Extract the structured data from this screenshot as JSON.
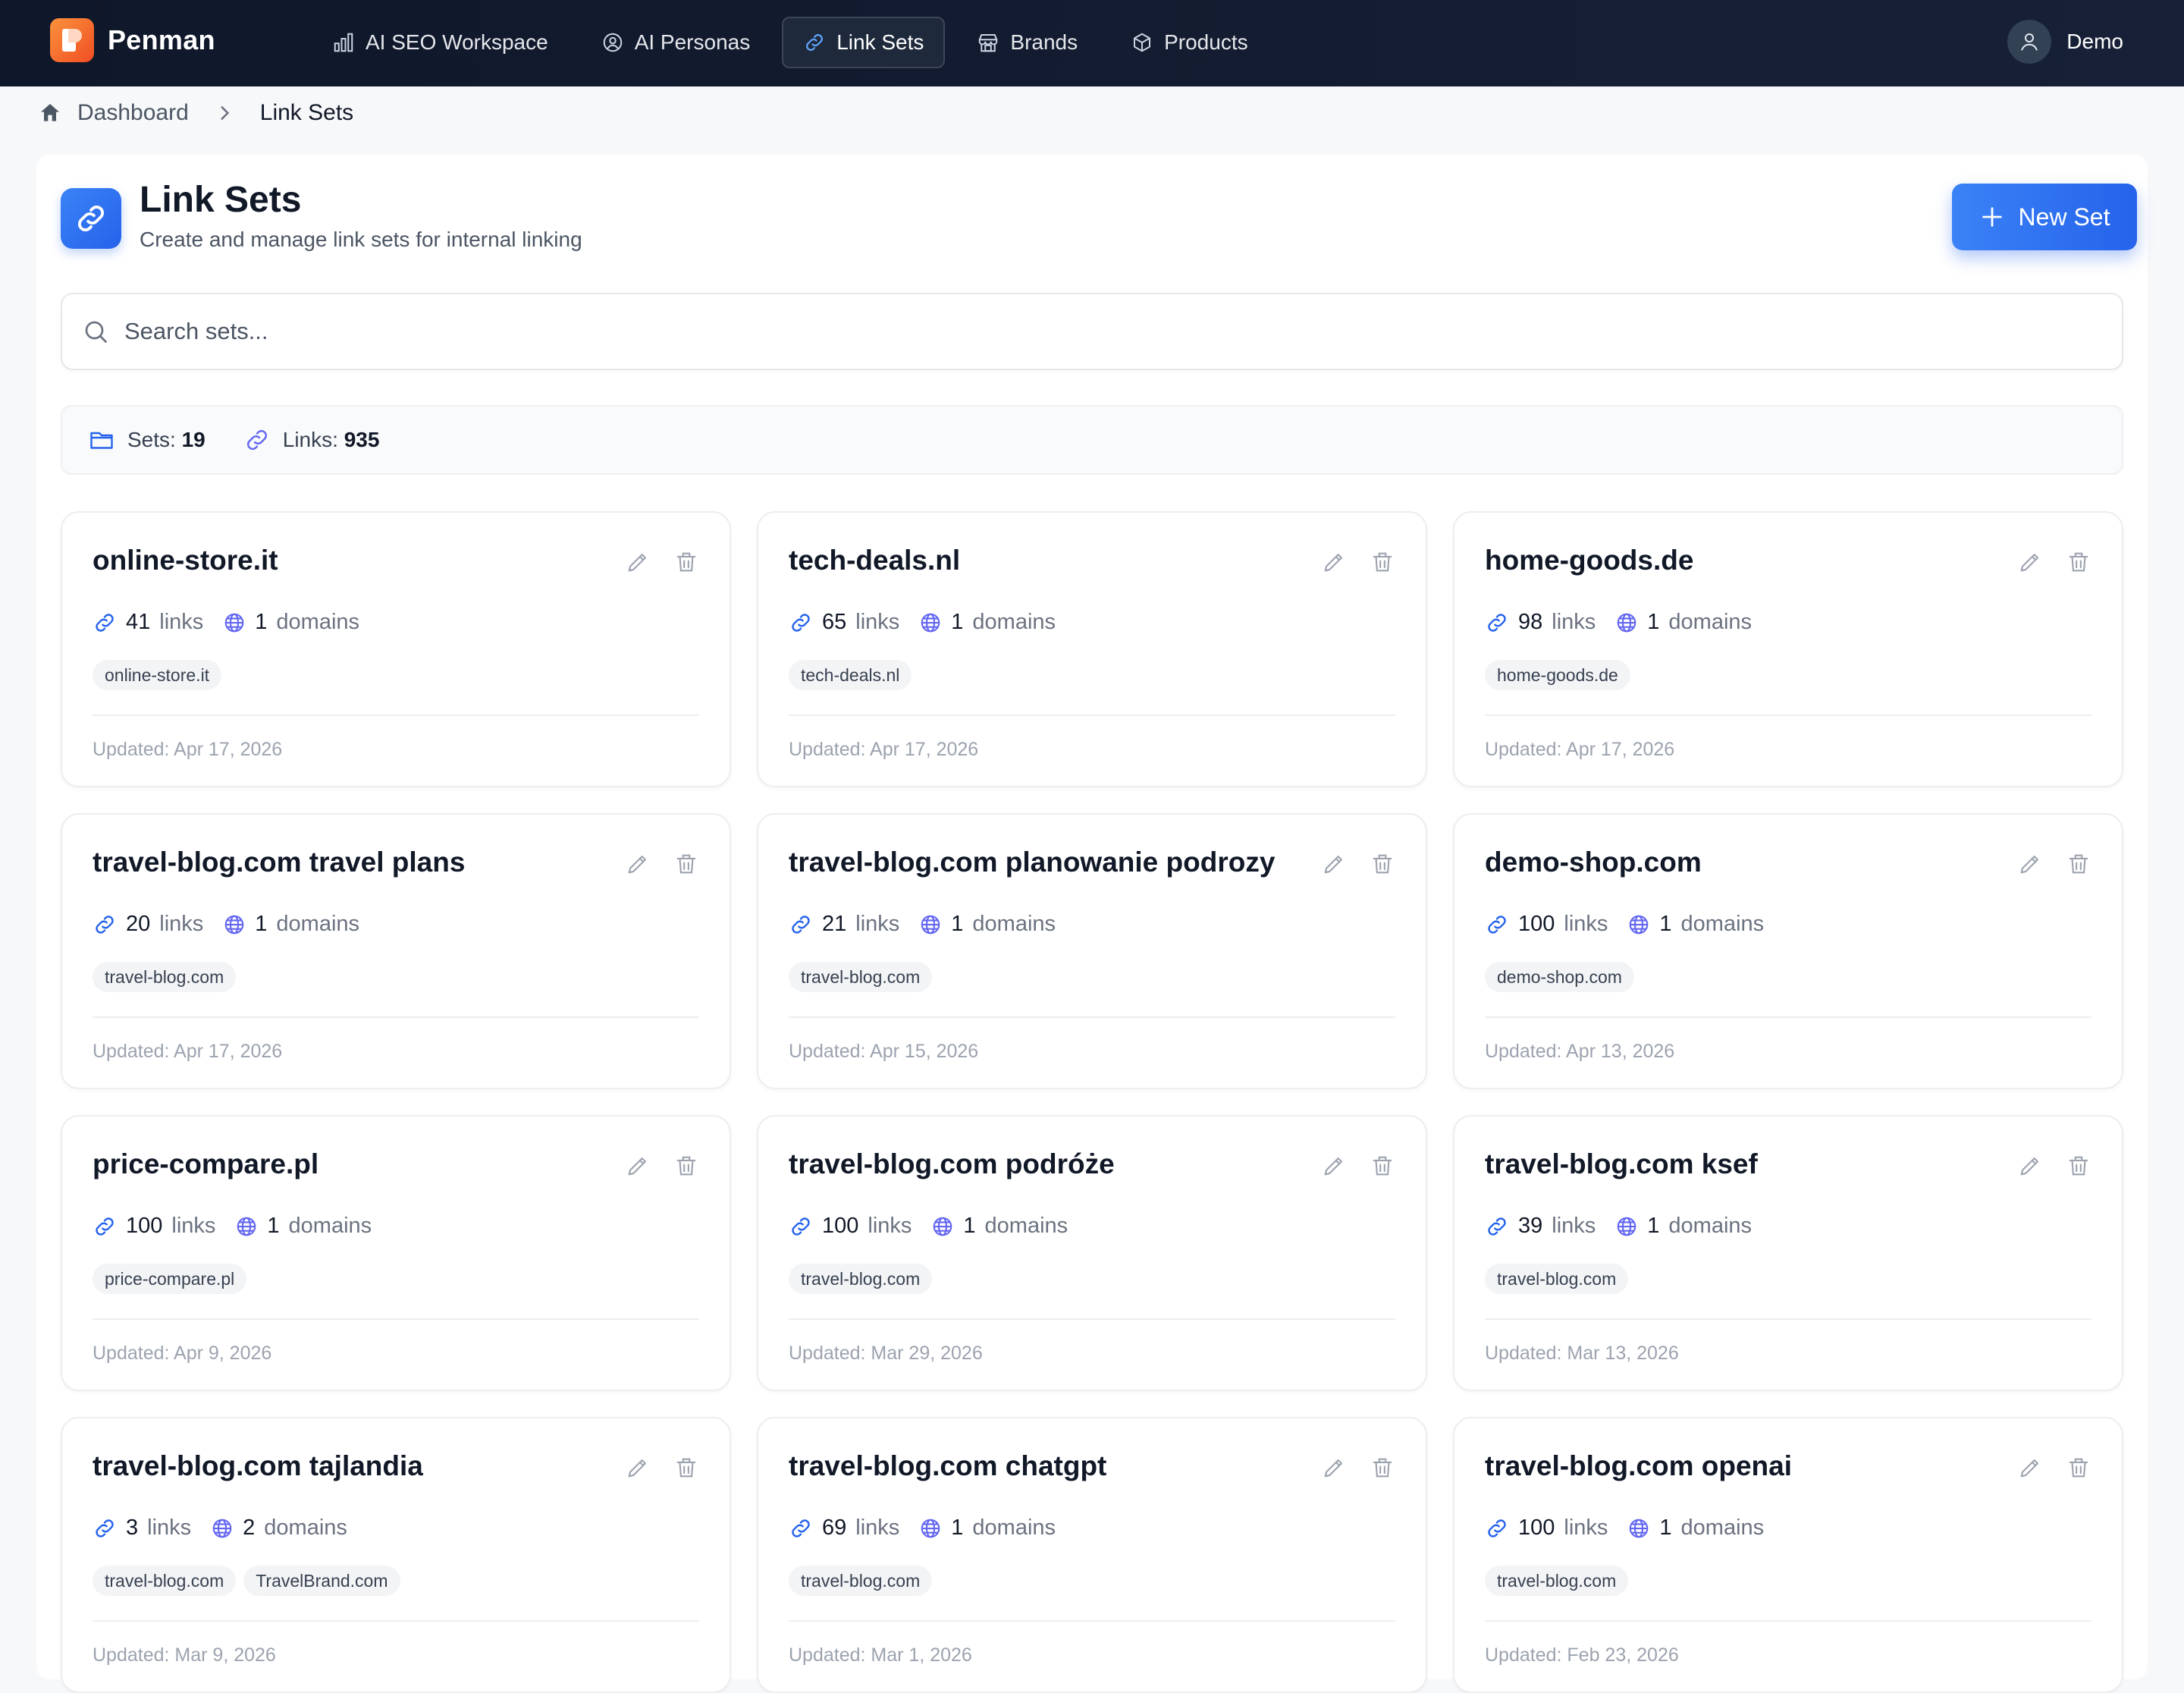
{
  "brand": {
    "name": "Penman"
  },
  "nav": {
    "items": [
      {
        "label": "AI SEO Workspace",
        "icon": "bar-chart-icon",
        "active": false
      },
      {
        "label": "AI Personas",
        "icon": "user-circle-icon",
        "active": false
      },
      {
        "label": "Link Sets",
        "icon": "link-icon",
        "active": true
      },
      {
        "label": "Brands",
        "icon": "store-icon",
        "active": false
      },
      {
        "label": "Products",
        "icon": "box-icon",
        "active": false
      }
    ],
    "user": "Demo"
  },
  "breadcrumb": {
    "home": "Dashboard",
    "current": "Link Sets"
  },
  "header": {
    "title": "Link Sets",
    "subtitle": "Create and manage link sets for internal linking",
    "new_button": "New Set"
  },
  "search": {
    "placeholder": "Search sets...",
    "value": ""
  },
  "stats": {
    "sets_label": "Sets:",
    "sets_value": "19",
    "links_label": "Links:",
    "links_value": "935"
  },
  "labels": {
    "links": "links",
    "domains": "domains"
  },
  "colors": {
    "accent": "#2563eb",
    "navbar": "#0f172a",
    "domain_icon": "#6366f1"
  },
  "sets": [
    {
      "name": "online-store.it",
      "links": "41",
      "domains": "1",
      "tags": [
        "online-store.it"
      ],
      "updated": "Updated: Apr 17, 2026"
    },
    {
      "name": "tech-deals.nl",
      "links": "65",
      "domains": "1",
      "tags": [
        "tech-deals.nl"
      ],
      "updated": "Updated: Apr 17, 2026"
    },
    {
      "name": "home-goods.de",
      "links": "98",
      "domains": "1",
      "tags": [
        "home-goods.de"
      ],
      "updated": "Updated: Apr 17, 2026"
    },
    {
      "name": "travel-blog.com travel plans",
      "links": "20",
      "domains": "1",
      "tags": [
        "travel-blog.com"
      ],
      "updated": "Updated: Apr 17, 2026"
    },
    {
      "name": "travel-blog.com planowanie podrozy",
      "links": "21",
      "domains": "1",
      "tags": [
        "travel-blog.com"
      ],
      "updated": "Updated: Apr 15, 2026"
    },
    {
      "name": "demo-shop.com",
      "links": "100",
      "domains": "1",
      "tags": [
        "demo-shop.com"
      ],
      "updated": "Updated: Apr 13, 2026"
    },
    {
      "name": "price-compare.pl",
      "links": "100",
      "domains": "1",
      "tags": [
        "price-compare.pl"
      ],
      "updated": "Updated: Apr 9, 2026"
    },
    {
      "name": "travel-blog.com podróże",
      "links": "100",
      "domains": "1",
      "tags": [
        "travel-blog.com"
      ],
      "updated": "Updated: Mar 29, 2026"
    },
    {
      "name": "travel-blog.com ksef",
      "links": "39",
      "domains": "1",
      "tags": [
        "travel-blog.com"
      ],
      "updated": "Updated: Mar 13, 2026"
    },
    {
      "name": "travel-blog.com tajlandia",
      "links": "3",
      "domains": "2",
      "tags": [
        "travel-blog.com",
        "TravelBrand.com"
      ],
      "updated": "Updated: Mar 9, 2026"
    },
    {
      "name": "travel-blog.com chatgpt",
      "links": "69",
      "domains": "1",
      "tags": [
        "travel-blog.com"
      ],
      "updated": "Updated: Mar 1, 2026"
    },
    {
      "name": "travel-blog.com openai",
      "links": "100",
      "domains": "1",
      "tags": [
        "travel-blog.com"
      ],
      "updated": "Updated: Feb 23, 2026"
    }
  ]
}
